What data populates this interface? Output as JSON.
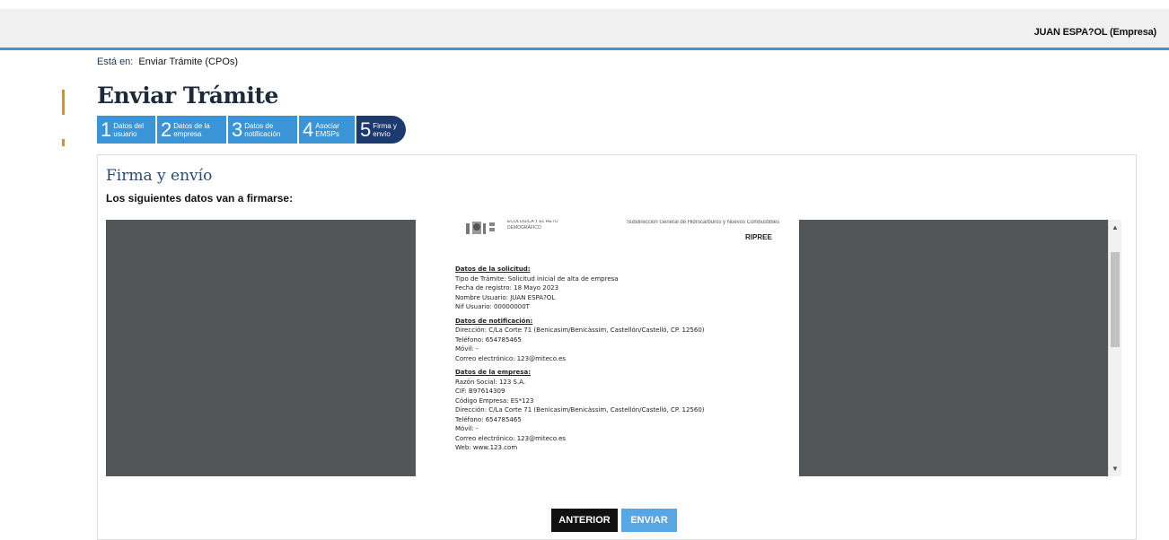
{
  "header": {
    "user_label": "JUAN ESPA?OL  (Empresa)"
  },
  "breadcrumb": {
    "prefix": "Está en:",
    "current": "Enviar Trámite (CPOs)"
  },
  "page": {
    "title": "Enviar Trámite"
  },
  "steps": [
    {
      "num": "1",
      "label": "Datos del usuario"
    },
    {
      "num": "2",
      "label": "Datos de la empresa"
    },
    {
      "num": "3",
      "label": "Datos de notificación"
    },
    {
      "num": "4",
      "label": "Asociar EMSPs"
    },
    {
      "num": "5",
      "label": "Firma y envío"
    }
  ],
  "section": {
    "title": "Firma y envío",
    "subtitle": "Los siguientes datos van a firmarse:"
  },
  "document": {
    "ministry": "ECOLÓGICA Y EL RETO\nDEMOGRÁFICO",
    "subdir": "Subdirección General de Hidrocarburos y Nuevos Combustibles",
    "ripree": "RIPREE",
    "lines": [
      {
        "t": "Datos de la solicitud:",
        "h": true
      },
      {
        "t": "Tipo de Trámite: Solicitud inicial de alta de empresa"
      },
      {
        "t": "Fecha de registro: 18 Mayo 2023"
      },
      {
        "t": "Nombre Usuario: JUAN ESPA?OL"
      },
      {
        "t": "Nif Usuario: 00000000T"
      },
      {
        "t": ""
      },
      {
        "t": "Datos de notificación:",
        "h": true
      },
      {
        "t": "Dirección: C/La Corte 71 (Benicasim/Benicàssim, Castellón/Castelló, CP. 12560)"
      },
      {
        "t": "Teléfono: 654785465"
      },
      {
        "t": "Móvil: -"
      },
      {
        "t": "Correo electrónico: 123@miteco.es"
      },
      {
        "t": ""
      },
      {
        "t": "Datos de la empresa:",
        "h": true
      },
      {
        "t": "Razón Social: 123 S.A."
      },
      {
        "t": "CIF: B97614309"
      },
      {
        "t": "Código Empresa: ES*123"
      },
      {
        "t": "Dirección: C/La Corte 71 (Benicasim/Benicàssim, Castellón/Castelló, CP. 12560)"
      },
      {
        "t": "Teléfono: 654785465"
      },
      {
        "t": "Móvil: -"
      },
      {
        "t": "Correo electrónico: 123@miteco.es"
      },
      {
        "t": "Web: www.123.com"
      }
    ]
  },
  "buttons": {
    "previous": "ANTERIOR",
    "send": "ENVIAR"
  },
  "colors": {
    "accent_blue": "#3a94d6",
    "active_step": "#1d3a6e",
    "orange_marker": "#e8891c"
  }
}
